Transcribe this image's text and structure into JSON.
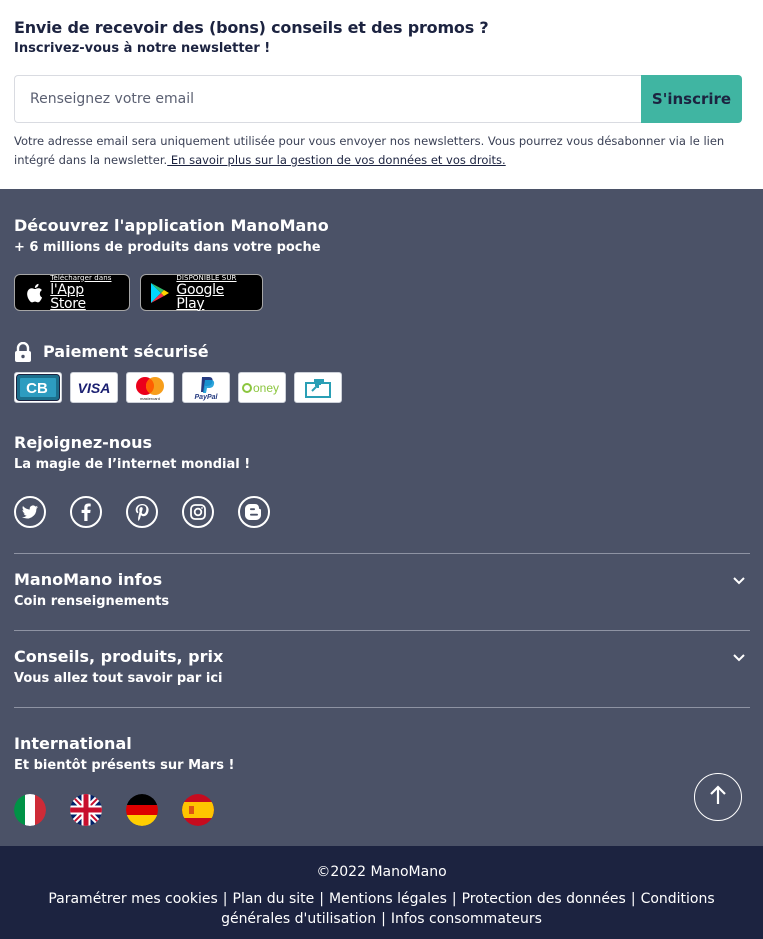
{
  "newsletter": {
    "title": "Envie de recevoir des (bons) conseils et des promos ?",
    "subtitle": "Inscrivez-vous à notre newsletter !",
    "email_placeholder": "Renseignez votre email",
    "email_value": "",
    "submit_label": "S'inscrire",
    "legal_text": "Votre adresse email sera uniquement utilisée pour vous envoyer nos newsletters. Vous pourrez vous désabonner via le lien intégré dans la newsletter.",
    "legal_link": " En savoir plus sur la gestion de vos données et vos droits."
  },
  "app": {
    "title": "Découvrez l'application ManoMano",
    "subtitle": "+ 6 millions de produits dans votre poche",
    "appstore_small": "Télécharger dans",
    "appstore_big": "l'App Store",
    "googleplay_small": "DISPONIBLE SUR",
    "googleplay_big": "Google Play"
  },
  "payment": {
    "title": "Paiement sécurisé",
    "methods": [
      "CB",
      "VISA",
      "mastercard",
      "PayPal",
      "oney",
      "virement"
    ]
  },
  "join": {
    "title": "Rejoignez-nous",
    "subtitle": "La magie de l’internet mondial !",
    "networks": [
      "twitter-icon",
      "facebook-icon",
      "pinterest-icon",
      "instagram-icon",
      "blogger-icon"
    ]
  },
  "accordion": [
    {
      "title": "ManoMano infos",
      "subtitle": "Coin renseignements"
    },
    {
      "title": "Conseils, produits, prix",
      "subtitle": "Vous allez tout savoir par ici"
    }
  ],
  "international": {
    "title": "International",
    "subtitle": "Et bientôt présents sur Mars !",
    "flags": [
      "italy",
      "united-kingdom",
      "germany",
      "spain"
    ]
  },
  "bottom": {
    "copyright": "©2022 ManoMano",
    "links": [
      "Paramétrer mes cookies",
      "Plan du site",
      "Mentions légales",
      "Protection des données",
      "Conditions générales d'utilisation",
      "Infos consommateurs"
    ],
    "separator": "|"
  },
  "colors": {
    "footer_bg": "#4b5267",
    "bottom_bg": "#1c2340",
    "accent": "#40b5a2",
    "text_dark": "#1c2340"
  }
}
